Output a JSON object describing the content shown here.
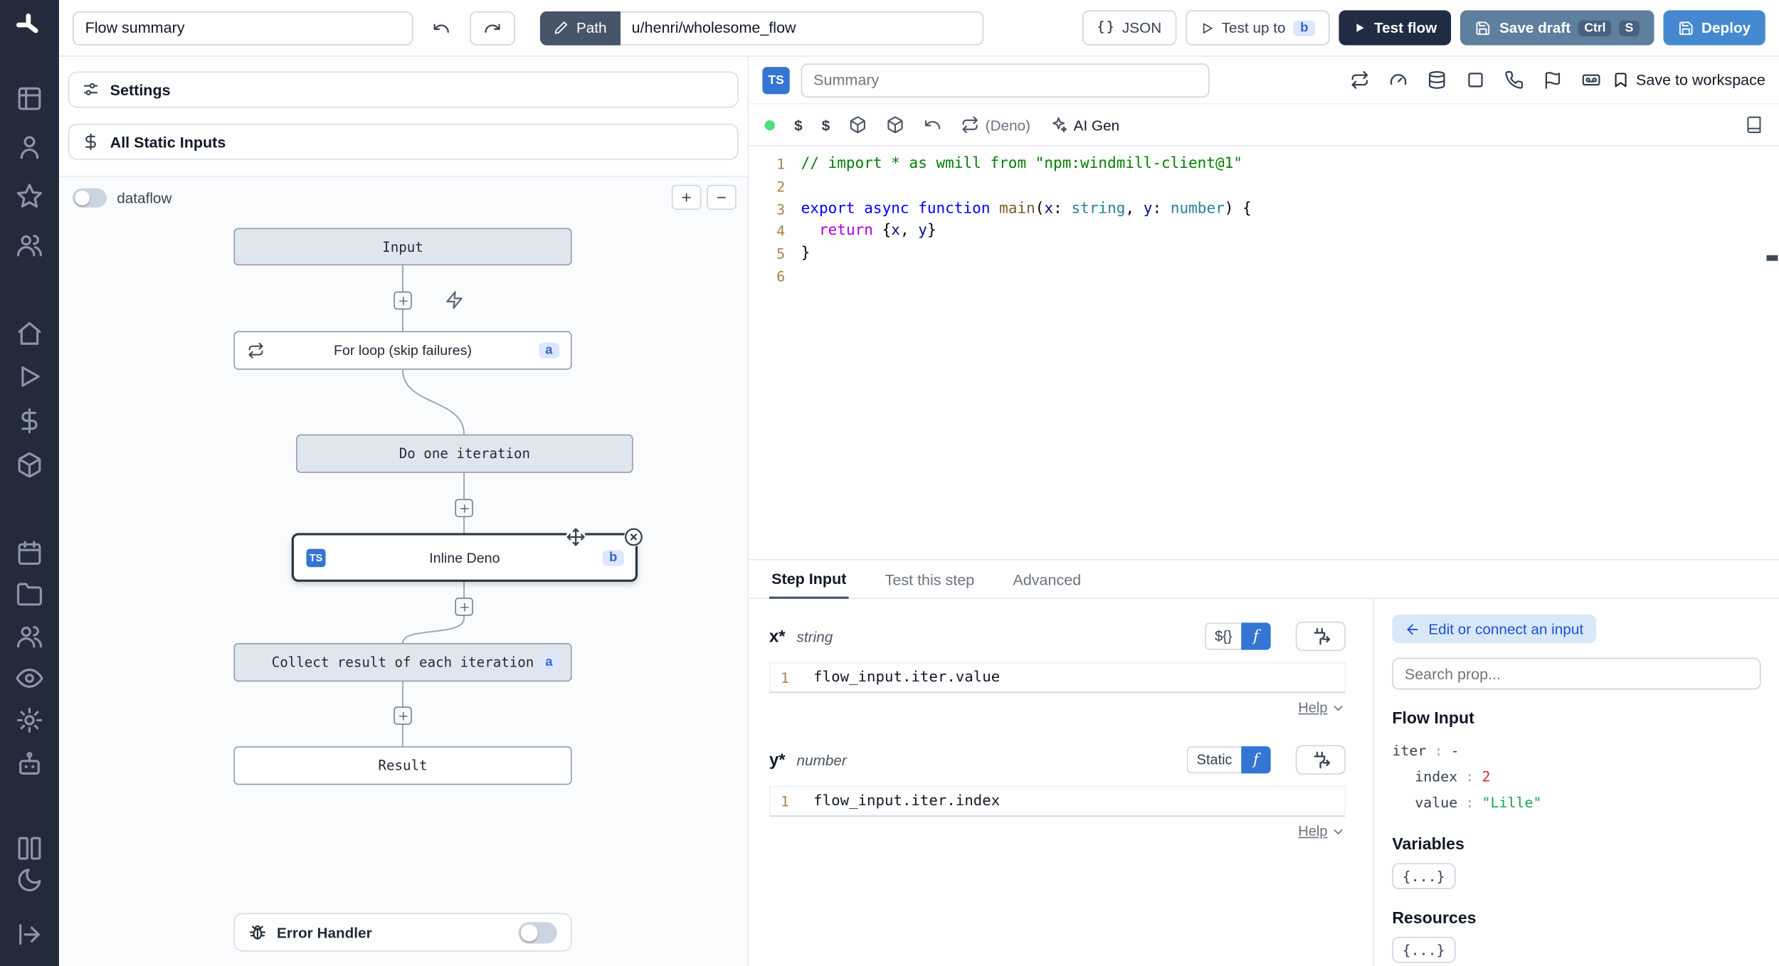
{
  "topbar": {
    "flow_summary": "Flow summary",
    "path_label": "Path",
    "path_value": "u/henri/wholesome_flow",
    "json_label": "JSON",
    "test_up_to": "Test up to",
    "test_up_to_badge": "b",
    "test_flow": "Test flow",
    "save_draft": "Save draft",
    "kbd_ctrl": "Ctrl",
    "kbd_s": "S",
    "deploy": "Deploy"
  },
  "sidebar": {
    "icons": [
      "windmill-logo",
      "table-icon",
      "user-icon",
      "star-icon",
      "users-icon",
      "home-icon",
      "play-icon",
      "dollar-icon",
      "box-icon",
      "calendar-icon",
      "folder-icon",
      "group-icon",
      "eye-icon",
      "gear-icon",
      "bot-icon",
      "panels-icon",
      "moon-icon",
      "expand-icon"
    ]
  },
  "flow_panel": {
    "settings": "Settings",
    "all_static_inputs": "All Static Inputs",
    "dataflow": "dataflow",
    "zoom_in": "+",
    "zoom_out": "−",
    "input_node": "Input",
    "forloop_node": "For loop (skip failures)",
    "forloop_badge": "a",
    "iteration_node": "Do one iteration",
    "inline_node": "Inline Deno",
    "inline_badge": "b",
    "ts_badge": "TS",
    "collect_node": "Collect result of each iteration",
    "collect_badge": "a",
    "result_node": "Result",
    "error_handler": "Error Handler"
  },
  "editor": {
    "ts_badge": "TS",
    "summary_placeholder": "Summary",
    "header_icons": [
      "repeat-icon",
      "gauge-icon",
      "database-icon",
      "square-icon",
      "phone-icon",
      "flag-icon",
      "tape-icon"
    ],
    "save_to_workspace": "Save to workspace",
    "dollar1": "$",
    "dollar2": "$",
    "deno": "(Deno)",
    "ai_gen": "AI Gen",
    "code": [
      {
        "n": "1",
        "tokens": [
          {
            "t": "// import * as wmill from \"npm:windmill-client@1\"",
            "c": "tok-comment"
          }
        ]
      },
      {
        "n": "2",
        "tokens": []
      },
      {
        "n": "3",
        "tokens": [
          {
            "t": "export ",
            "c": "tok-kw"
          },
          {
            "t": "async ",
            "c": "tok-kw"
          },
          {
            "t": "function ",
            "c": "tok-kw"
          },
          {
            "t": "main",
            "c": "tok-fn"
          },
          {
            "t": "(",
            "c": ""
          },
          {
            "t": "x",
            "c": "tok-param"
          },
          {
            "t": ": ",
            "c": ""
          },
          {
            "t": "string",
            "c": "tok-type"
          },
          {
            "t": ", ",
            "c": ""
          },
          {
            "t": "y",
            "c": "tok-param"
          },
          {
            "t": ": ",
            "c": ""
          },
          {
            "t": "number",
            "c": "tok-type"
          },
          {
            "t": ") {",
            "c": ""
          }
        ]
      },
      {
        "n": "4",
        "tokens": [
          {
            "t": "  ",
            "c": ""
          },
          {
            "t": "return",
            "c": "tok-ctrl"
          },
          {
            "t": " {",
            "c": ""
          },
          {
            "t": "x",
            "c": "tok-param"
          },
          {
            "t": ", ",
            "c": ""
          },
          {
            "t": "y",
            "c": "tok-param"
          },
          {
            "t": "}",
            "c": ""
          }
        ]
      },
      {
        "n": "5",
        "tokens": [
          {
            "t": "}",
            "c": ""
          }
        ]
      },
      {
        "n": "6",
        "tokens": []
      }
    ]
  },
  "step_panel": {
    "tabs": [
      "Step Input",
      "Test this step",
      "Advanced"
    ],
    "fields": [
      {
        "name": "x",
        "star": "*",
        "type": "string",
        "mode": "${}",
        "fx": "f",
        "line_no": "1",
        "expr": "flow_input.iter.value",
        "help": "Help"
      },
      {
        "name": "y",
        "star": "*",
        "type": "number",
        "mode": "Static",
        "fx": "f",
        "line_no": "1",
        "expr": "flow_input.iter.index",
        "help": "Help"
      }
    ]
  },
  "prop_picker": {
    "edit_connect": "Edit or connect an input",
    "search_placeholder": "Search prop...",
    "flow_input": "Flow Input",
    "props": [
      {
        "key": "iter",
        "sep": ":",
        "value": "-"
      },
      {
        "key": "index",
        "sep": ":",
        "value": "2"
      },
      {
        "key": "value",
        "sep": ":",
        "value": "\"Lille\""
      }
    ],
    "variables": "Variables",
    "variables_btn": "{...}",
    "resources": "Resources",
    "resources_btn": "{...}"
  }
}
